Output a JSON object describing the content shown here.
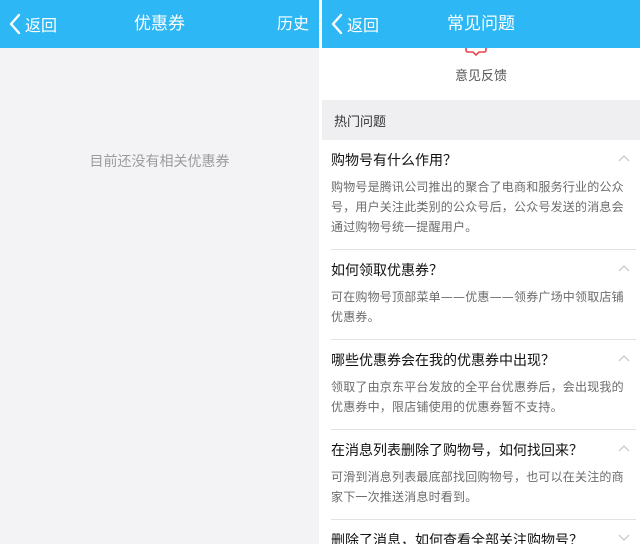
{
  "left": {
    "navbar": {
      "back_label": "返回",
      "title": "优惠券",
      "right_action": "历史"
    },
    "empty_message": "目前还没有相关优惠券"
  },
  "right": {
    "navbar": {
      "back_label": "返回",
      "title": "常见问题"
    },
    "feedback_label": "意见反馈",
    "section_title": "热门问题",
    "faqs": [
      {
        "question": "购物号有什么作用？",
        "answer": "购物号是腾讯公司推出的聚合了电商和服务行业的公众号，用户关注此类别的公众号后，公众号发送的消息会通过购物号统一提醒用户。",
        "expanded": true
      },
      {
        "question": "如何领取优惠券？",
        "answer": "可在购物号顶部菜单——优惠——领券广场中领取店铺优惠券。",
        "expanded": true
      },
      {
        "question": "哪些优惠券会在我的优惠券中出现？",
        "answer": "领取了由京东平台发放的全平台优惠券后，会出现我的优惠券中，限店铺使用的优惠券暂不支持。",
        "expanded": true
      },
      {
        "question": "在消息列表删除了购物号，如何找回来？",
        "answer": "可滑到消息列表最底部找回购物号，也可以在关注的商家下一次推送消息时看到。",
        "expanded": true
      },
      {
        "question": "删除了消息，如何查看全部关注购物号？",
        "answer": "",
        "expanded": false
      }
    ]
  },
  "colors": {
    "navbar": "#2db7f5",
    "feedback_icon": "#e8464f",
    "section_bg": "#efeff2"
  }
}
